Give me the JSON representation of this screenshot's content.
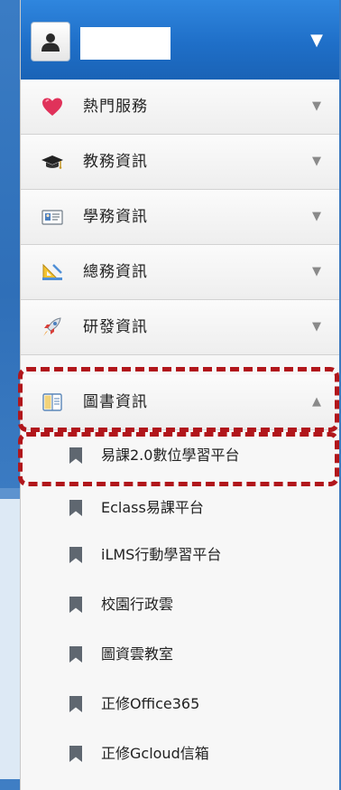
{
  "user": {
    "name": "",
    "caret": "▼"
  },
  "menu": [
    {
      "label": "熱門服務",
      "icon": "heart-icon",
      "caret": "▼"
    },
    {
      "label": "教務資訊",
      "icon": "graduation-cap-icon",
      "caret": "▼"
    },
    {
      "label": "學務資訊",
      "icon": "id-card-icon",
      "caret": "▼"
    },
    {
      "label": "總務資訊",
      "icon": "ruler-triangle-icon",
      "caret": "▼"
    },
    {
      "label": "研發資訊",
      "icon": "rocket-icon",
      "caret": "▼"
    },
    {
      "label": "圖書資訊",
      "icon": "book-icon",
      "caret": "▲",
      "expanded": true
    }
  ],
  "submenu": [
    {
      "label": "易課2.0數位學習平台",
      "icon": "bookmark-icon"
    },
    {
      "label": "Eclass易課平台",
      "icon": "bookmark-icon"
    },
    {
      "label": "iLMS行動學習平台",
      "icon": "bookmark-icon"
    },
    {
      "label": "校園行政雲",
      "icon": "bookmark-icon"
    },
    {
      "label": "圖資雲教室",
      "icon": "bookmark-icon"
    },
    {
      "label": "正修Office365",
      "icon": "bookmark-icon"
    },
    {
      "label": "正修Gcloud信箱",
      "icon": "bookmark-icon"
    }
  ],
  "colors": {
    "header_blue": "#1f6fc8",
    "highlight_red": "#b1161b",
    "bookmark_gray": "#5f6770"
  }
}
